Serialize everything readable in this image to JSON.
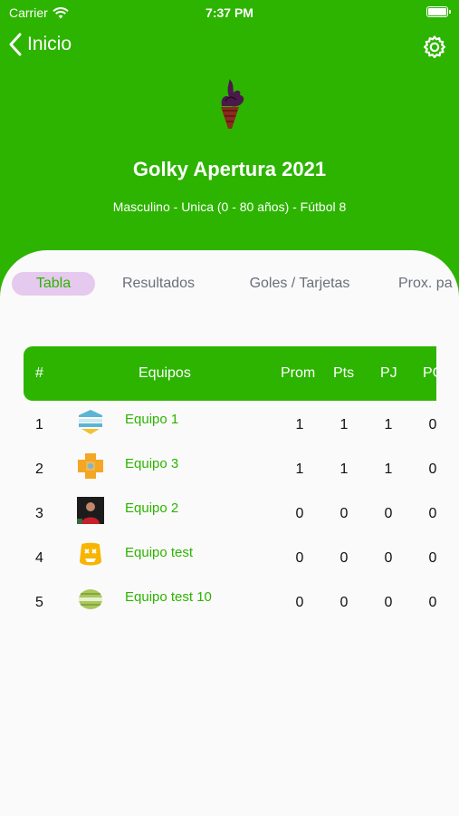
{
  "status_bar": {
    "carrier": "Carrier",
    "time": "7:37 PM"
  },
  "nav": {
    "back_label": "Inicio"
  },
  "tournament": {
    "title": "Golky Apertura 2021",
    "subtitle": "Masculino - Unica (0 - 80 años) - Fútbol 8"
  },
  "tabs": [
    {
      "label": "Tabla",
      "active": true
    },
    {
      "label": "Resultados",
      "active": false
    },
    {
      "label": "Goles / Tarjetas",
      "active": false
    },
    {
      "label": "Prox. pa",
      "active": false
    }
  ],
  "table": {
    "headers": {
      "pos": "#",
      "team": "Equipos",
      "prom": "Prom",
      "pts": "Pts",
      "pj": "PJ",
      "pg": "PG"
    },
    "rows": [
      {
        "pos": "1",
        "team": "Equipo 1",
        "prom": "1",
        "pts": "1",
        "pj": "1",
        "pg": "0",
        "crest_icon": "striped-shield-icon"
      },
      {
        "pos": "2",
        "team": "Equipo 3",
        "prom": "1",
        "pts": "1",
        "pj": "1",
        "pg": "0",
        "crest_icon": "orange-cross-crest-icon"
      },
      {
        "pos": "3",
        "team": "Equipo 2",
        "prom": "0",
        "pts": "0",
        "pj": "0",
        "pg": "0",
        "crest_icon": "team-photo-icon"
      },
      {
        "pos": "4",
        "team": "Equipo test",
        "prom": "0",
        "pts": "0",
        "pj": "0",
        "pg": "0",
        "crest_icon": "yellow-mascot-crest-icon"
      },
      {
        "pos": "5",
        "team": "Equipo test 10",
        "prom": "0",
        "pts": "0",
        "pj": "0",
        "pg": "0",
        "crest_icon": "green-ball-crest-icon"
      }
    ]
  },
  "colors": {
    "brand_green": "#2db400",
    "active_tab_bg": "#e6c9ee",
    "sheet_bg": "#fafafa"
  }
}
